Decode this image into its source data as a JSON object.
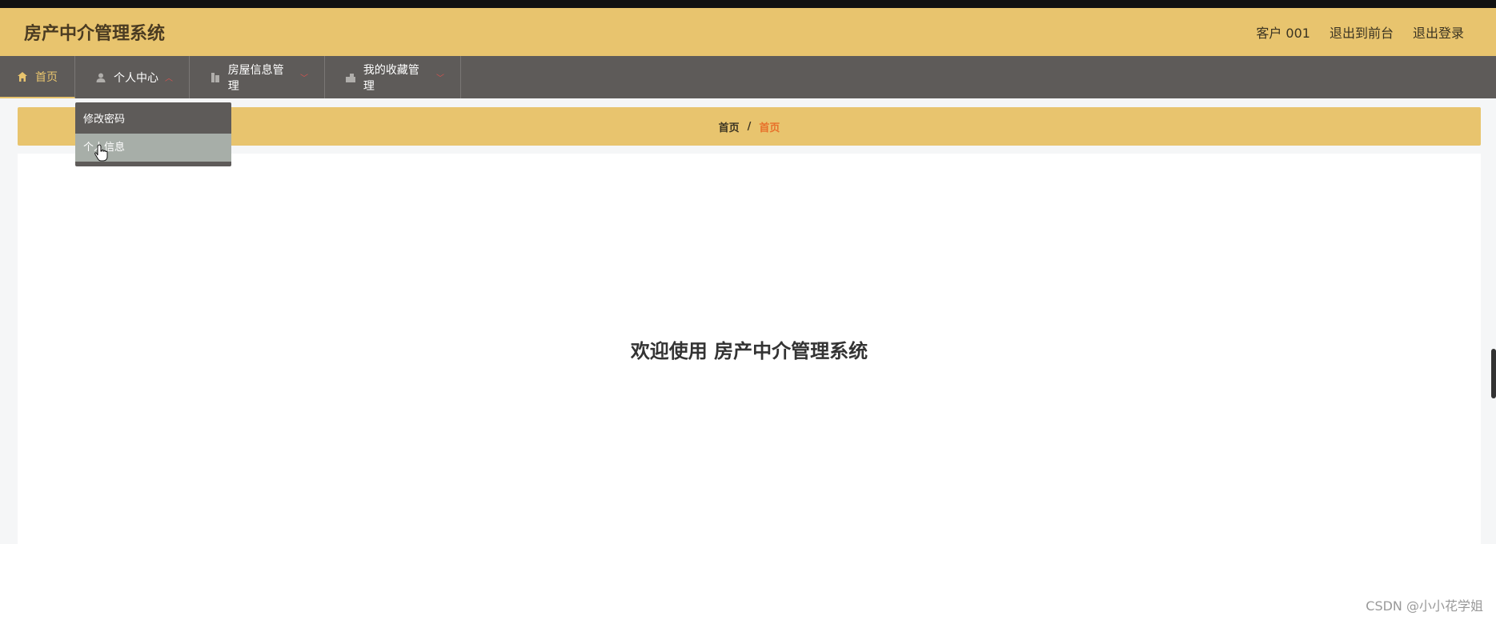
{
  "header": {
    "title": "房产中介管理系统",
    "user": "客户 001",
    "exit_front": "退出到前台",
    "logout": "退出登录"
  },
  "nav": {
    "home": "首页",
    "personal": "个人中心",
    "house": "房屋信息管理",
    "favorites": "我的收藏管理"
  },
  "dropdown": {
    "items": [
      "修改密码",
      "个人信息"
    ]
  },
  "breadcrumb": {
    "root": "首页",
    "separator": "/",
    "current": "首页"
  },
  "main": {
    "welcome": "欢迎使用 房产中介管理系统"
  },
  "watermark": "CSDN @小小花学姐",
  "colors": {
    "accent": "#e8c46e",
    "nav_bg": "#5e5b59",
    "highlight": "#e8702a"
  }
}
